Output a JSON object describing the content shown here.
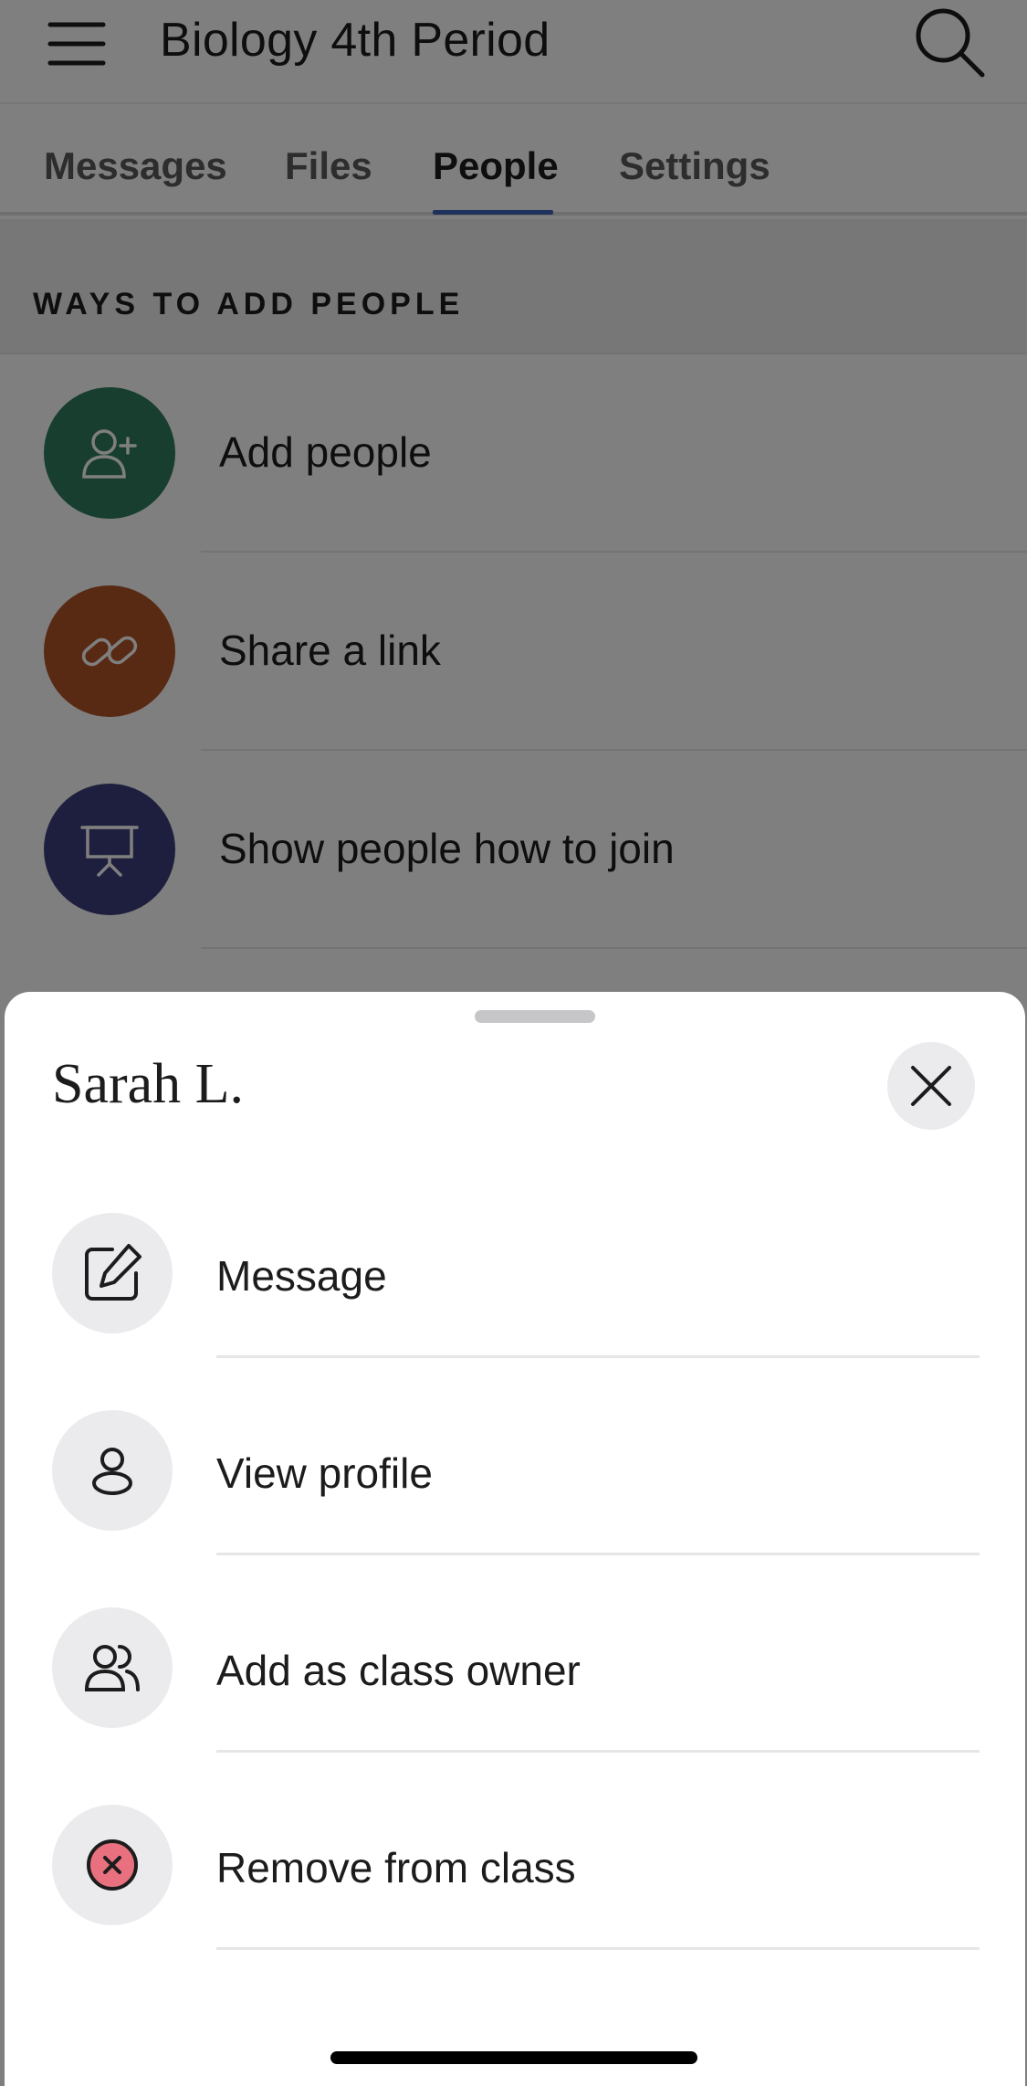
{
  "header": {
    "title": "Biology 4th Period"
  },
  "tabs": [
    {
      "label": "Messages",
      "active": false
    },
    {
      "label": "Files",
      "active": false
    },
    {
      "label": "People",
      "active": true
    },
    {
      "label": "Settings",
      "active": false
    }
  ],
  "section": {
    "heading": "WAYS TO ADD PEOPLE"
  },
  "add_options": [
    {
      "label": "Add people",
      "icon": "add-person-icon",
      "color": "#2f7d5d"
    },
    {
      "label": "Share a link",
      "icon": "link-icon",
      "color": "#b05527"
    },
    {
      "label": "Show people how to join",
      "icon": "presentation-board-icon",
      "color": "#3d3f7d"
    }
  ],
  "sheet": {
    "title": "Sarah L.",
    "actions": [
      {
        "label": "Message",
        "icon": "compose-icon"
      },
      {
        "label": "View profile",
        "icon": "person-icon"
      },
      {
        "label": "Add as class owner",
        "icon": "people-icon"
      },
      {
        "label": "Remove from class",
        "icon": "remove-icon",
        "color": "#e8707f"
      }
    ]
  }
}
